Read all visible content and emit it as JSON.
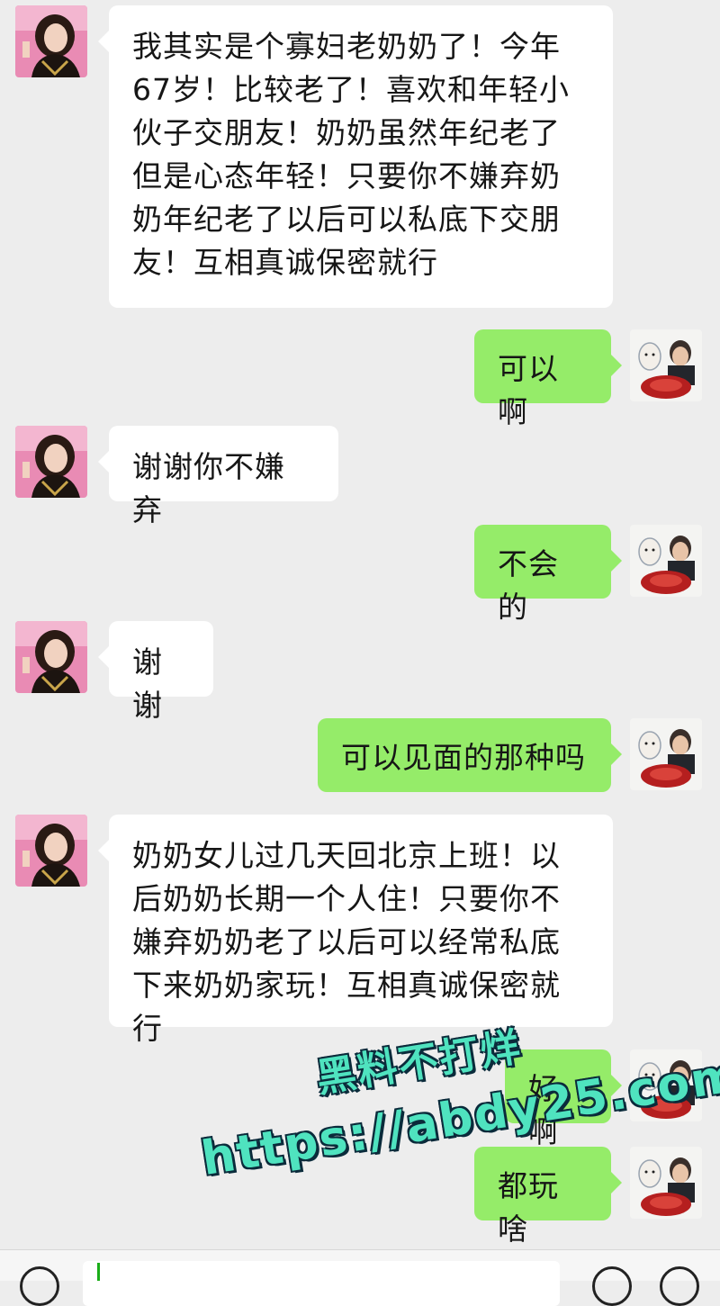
{
  "messages": [
    {
      "side": "left",
      "text": "我其实是个寡妇老奶奶了！今年 67岁！比较老了！喜欢和年轻小伙子交朋友！奶奶虽然年纪老了但是心态年轻！只要你不嫌弃奶奶年纪老了以后可以私底下交朋友！互相真诚保密就行"
    },
    {
      "side": "right",
      "text": "可以啊"
    },
    {
      "side": "left",
      "text": "谢谢你不嫌弃"
    },
    {
      "side": "right",
      "text": "不会的"
    },
    {
      "side": "left",
      "text": "谢谢"
    },
    {
      "side": "right",
      "text": "可以见面的那种吗"
    },
    {
      "side": "left",
      "text": "奶奶女儿过几天回北京上班！以后奶奶长期一个人住！只要你不嫌弃奶奶老了以后可以经常私底下来奶奶家玩！互相真诚保密就行"
    },
    {
      "side": "right",
      "text": "好啊"
    },
    {
      "side": "right",
      "text": "都玩啥"
    }
  ],
  "watermark": {
    "line1": "黑料不打烊",
    "line2": "https://abdy25.com"
  },
  "icons": {
    "voice": "voice-icon",
    "emoji": "emoji-icon",
    "plus": "plus-icon"
  },
  "colors": {
    "background": "#ededed",
    "sent_bubble": "#95ec69",
    "received_bubble": "#ffffff",
    "watermark": "#4fe3bf"
  }
}
